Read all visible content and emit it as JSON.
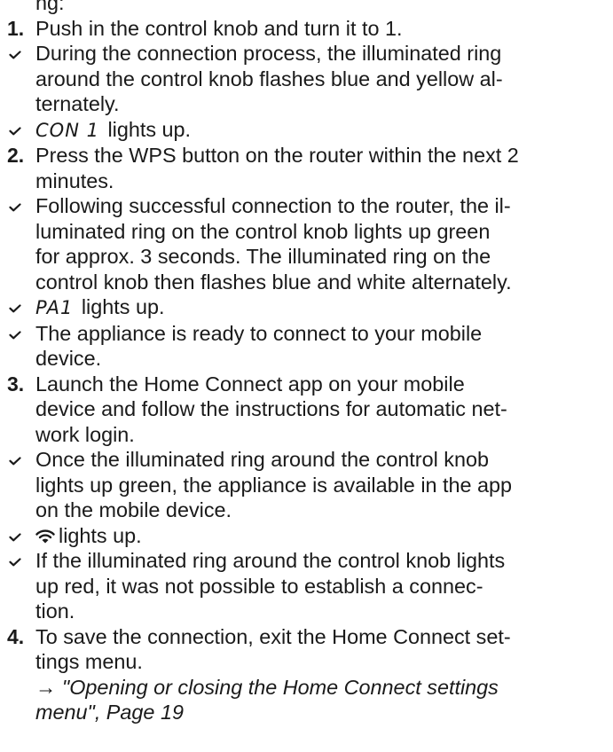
{
  "partial_heading": "ng:",
  "steps": {
    "s1": {
      "number": "1.",
      "text": "Push in the control knob and turn it to 1."
    },
    "r1": {
      "line1": "During the connection process, the illuminated ring",
      "line2": "around the control knob flashes blue and yellow al-",
      "line3": "ternately."
    },
    "r2": {
      "display": "CON 1",
      "text": "lights up."
    },
    "s2": {
      "number": "2.",
      "line1": "Press the WPS button on the router within the next 2",
      "line2": "minutes."
    },
    "r3": {
      "line1": "Following successful connection to the router, the il-",
      "line2": "luminated ring on the control knob lights up green",
      "line3": "for approx. 3 seconds. The illuminated ring on the",
      "line4": "control knob then flashes blue and white alternately."
    },
    "r4": {
      "display": "PA1",
      "text": "lights up."
    },
    "r5": {
      "line1": "The appliance is ready to connect to your mobile",
      "line2": "device."
    },
    "s3": {
      "number": "3.",
      "line1": "Launch the Home Connect app on your mobile",
      "line2": "device and follow the instructions for automatic net-",
      "line3": "work login."
    },
    "r6": {
      "line1": "Once the illuminated ring around the control knob",
      "line2": "lights up green, the appliance is available in the app",
      "line3": "on the mobile device."
    },
    "r7": {
      "icon": "wifi-icon",
      "text": "lights up."
    },
    "r8": {
      "line1": "If the illuminated ring around the control knob lights",
      "line2": "up red, it was not possible to establish a connec-",
      "line3": "tion."
    },
    "s4": {
      "number": "4.",
      "line1": "To save the connection, exit the Home Connect set-",
      "line2": "tings menu.",
      "line3": "→ \"Opening or closing the Home Connect settings",
      "line4": "menu\", Page 19"
    }
  },
  "colors": {
    "text": "#1a1a1a",
    "check": "#1a1a1a"
  }
}
